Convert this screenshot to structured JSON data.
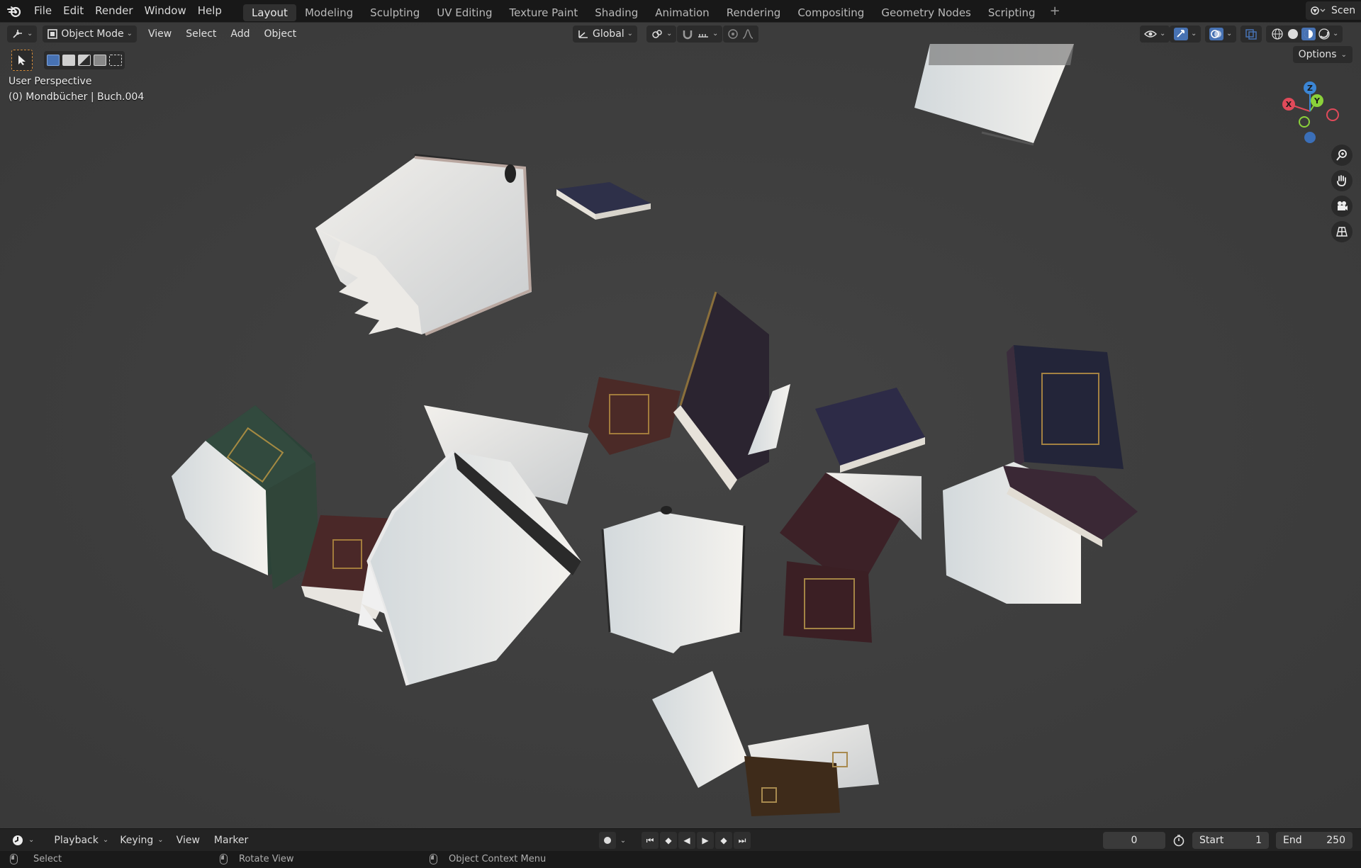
{
  "topbar": {
    "menus": [
      "File",
      "Edit",
      "Render",
      "Window",
      "Help"
    ],
    "workspaces": [
      "Layout",
      "Modeling",
      "Sculpting",
      "UV Editing",
      "Texture Paint",
      "Shading",
      "Animation",
      "Rendering",
      "Compositing",
      "Geometry Nodes",
      "Scripting"
    ],
    "active_workspace": "Layout",
    "add_workspace": "+",
    "scene_label": "Scen"
  },
  "viewport": {
    "header": {
      "mode": "Object Mode",
      "menus": [
        "View",
        "Select",
        "Add",
        "Object"
      ],
      "transform_orientation": "Global"
    },
    "options_label": "Options",
    "perspective_label": "User Perspective",
    "object_info": "(0) Mondbücher | Buch.004",
    "gizmo": {
      "x": "X",
      "y": "Y",
      "z": "Z"
    },
    "colors": {
      "background": "#3d3d3d",
      "accent": "#4772b3",
      "x_axis": "#e04a5a",
      "y_axis": "#8bd13a",
      "z_axis": "#3b86d6"
    }
  },
  "timeline": {
    "menus": [
      "Playback",
      "Keying",
      "View",
      "Marker"
    ],
    "current_frame": "0",
    "start_label": "Start",
    "start_value": "1",
    "end_label": "End",
    "end_value": "250"
  },
  "statusbar": {
    "select": "Select",
    "rotate": "Rotate View",
    "context": "Object Context Menu"
  }
}
